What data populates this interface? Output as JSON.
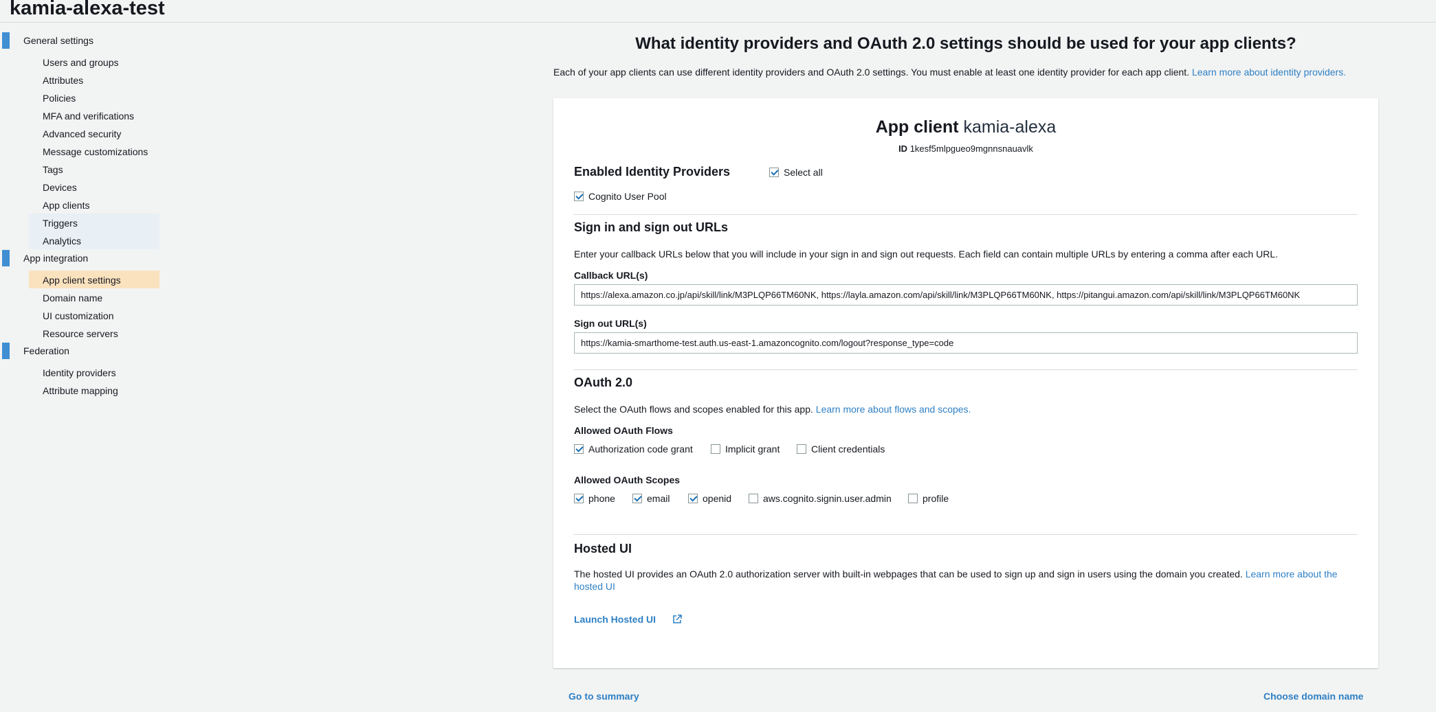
{
  "pool_name": "kamia-alexa-test",
  "sidebar": {
    "sections": [
      {
        "label": "General settings",
        "items": [
          "Users and groups",
          "Attributes",
          "Policies",
          "MFA and verifications",
          "Advanced security",
          "Message customizations",
          "Tags",
          "Devices",
          "App clients",
          "Triggers",
          "Analytics"
        ]
      },
      {
        "label": "App integration",
        "items": [
          "App client settings",
          "Domain name",
          "UI customization",
          "Resource servers"
        ]
      },
      {
        "label": "Federation",
        "items": [
          "Identity providers",
          "Attribute mapping"
        ]
      }
    ]
  },
  "main": {
    "title": "What identity providers and OAuth 2.0 settings should be used for your app clients?",
    "description": "Each of your app clients can use different identity providers and OAuth 2.0 settings. You must enable at least one identity provider for each app client.",
    "description_link": "Learn more about identity providers.",
    "client": {
      "title_prefix": "App client",
      "name": "kamia-alexa",
      "id_label": "ID",
      "id_value": "1kesf5mlpgueo9mgnnsnauavlk"
    },
    "identity_providers": {
      "heading": "Enabled Identity Providers",
      "select_all": "Select all",
      "select_all_checked": true,
      "cognito_label": "Cognito User Pool",
      "cognito_checked": true
    },
    "urls": {
      "heading": "Sign in and sign out URLs",
      "description": "Enter your callback URLs below that you will include in your sign in and sign out requests. Each field can contain multiple URLs by entering a comma after each URL.",
      "callback_label": "Callback URL(s)",
      "callback_value": "https://alexa.amazon.co.jp/api/skill/link/M3PLQP66TM60NK, https://layla.amazon.com/api/skill/link/M3PLQP66TM60NK, https://pitangui.amazon.com/api/skill/link/M3PLQP66TM60NK",
      "signout_label": "Sign out URL(s)",
      "signout_value": "https://kamia-smarthome-test.auth.us-east-1.amazoncognito.com/logout?response_type=code"
    },
    "oauth": {
      "heading": "OAuth 2.0",
      "description": "Select the OAuth flows and scopes enabled for this app.",
      "description_link": "Learn more about flows and scopes.",
      "flows_label": "Allowed OAuth Flows",
      "flows": [
        {
          "label": "Authorization code grant",
          "checked": true
        },
        {
          "label": "Implicit grant",
          "checked": false
        },
        {
          "label": "Client credentials",
          "checked": false
        }
      ],
      "scopes_label": "Allowed OAuth Scopes",
      "scopes": [
        {
          "label": "phone",
          "checked": true
        },
        {
          "label": "email",
          "checked": true
        },
        {
          "label": "openid",
          "checked": true
        },
        {
          "label": "aws.cognito.signin.user.admin",
          "checked": false
        },
        {
          "label": "profile",
          "checked": false
        }
      ]
    },
    "hosted_ui": {
      "heading": "Hosted UI",
      "description": "The hosted UI provides an OAuth 2.0 authorization server with built-in webpages that can be used to sign up and sign in users using the domain you created.",
      "link_line1": "Learn more about the",
      "link_line2": "hosted UI",
      "launch_label": "Launch Hosted UI"
    }
  },
  "footer": {
    "left_link": "Go to summary",
    "right_link": "Choose domain name"
  },
  "colors": {
    "accent": "#3f8fd2",
    "link": "#2f80c4",
    "active_item_bg": "#fbe2bf",
    "hover_item_bg": "#e8eff5",
    "page_bg": "#f2f3f3"
  }
}
